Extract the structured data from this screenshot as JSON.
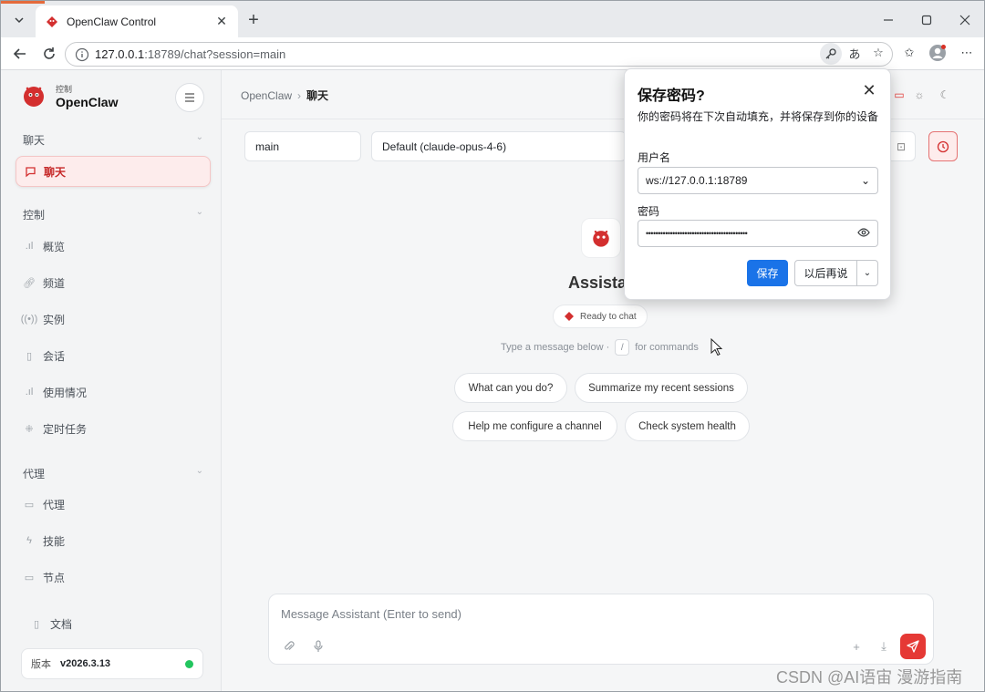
{
  "browser": {
    "tab_title": "OpenClaw Control",
    "url_host": "127.0.0.1",
    "url_rest": ":18789/chat?session=main"
  },
  "sidebar": {
    "brand_small": "控制",
    "brand_name": "OpenClaw",
    "sections": [
      {
        "label": "聊天",
        "items": [
          {
            "label": "聊天",
            "icon": "chat-icon",
            "active": true
          }
        ]
      },
      {
        "label": "控制",
        "items": [
          {
            "label": "概览",
            "icon": "bar-chart-icon"
          },
          {
            "label": "频道",
            "icon": "link-icon"
          },
          {
            "label": "实例",
            "icon": "broadcast-icon"
          },
          {
            "label": "会话",
            "icon": "document-icon"
          },
          {
            "label": "使用情况",
            "icon": "bar-chart-icon"
          },
          {
            "label": "定时任务",
            "icon": "spinner-icon"
          }
        ]
      },
      {
        "label": "代理",
        "items": [
          {
            "label": "代理",
            "icon": "folder-icon"
          },
          {
            "label": "技能",
            "icon": "lightning-icon"
          },
          {
            "label": "节点",
            "icon": "monitor-icon"
          }
        ]
      }
    ],
    "docs": "文档",
    "version_label": "版本",
    "version_value": "v2026.3.13"
  },
  "main": {
    "breadcrumb_root": "OpenClaw",
    "breadcrumb_current": "聊天",
    "session_value": "main",
    "model_value": "Default (claude-opus-4-6)",
    "assistant_title": "Assistant",
    "ready_text": "Ready to chat",
    "hint_before": "Type a message below ·",
    "hint_key": "/",
    "hint_after": "for commands",
    "chips": [
      "What can you do?",
      "Summarize my recent sessions",
      "Help me configure a channel",
      "Check system health"
    ],
    "composer_placeholder": "Message Assistant (Enter to send)"
  },
  "popup": {
    "title": "保存密码?",
    "description": "你的密码将在下次自动填充，并将保存到你的设备",
    "username_label": "用户名",
    "username_value": "ws://127.0.0.1:18789",
    "password_label": "密码",
    "password_value": "••••••••••••••••••••••••••••••••••••••••••",
    "save_label": "保存",
    "later_label": "以后再说"
  },
  "watermark": "CSDN @AI语宙 漫游指南",
  "colors": {
    "accent": "#e53935",
    "save_blue": "#1a73e8",
    "status_green": "#22c55e"
  }
}
